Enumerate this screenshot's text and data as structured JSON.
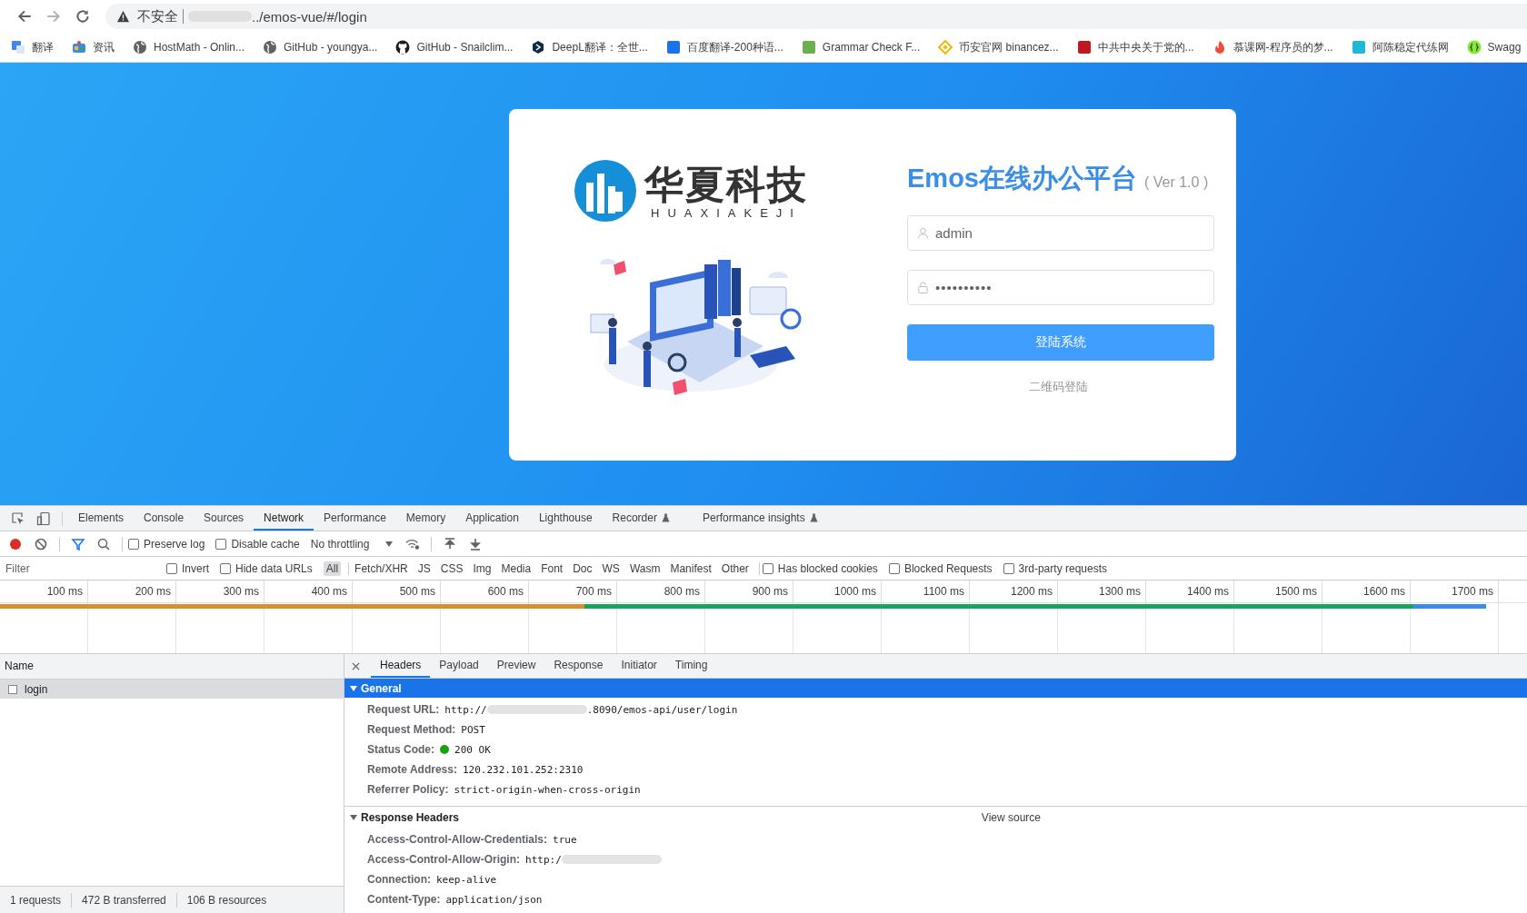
{
  "browser": {
    "security_label": "不安全",
    "url": "../emos-vue/#/login",
    "bookmarks": [
      {
        "kind": "translate",
        "label": "翻译"
      },
      {
        "kind": "news",
        "label": "资讯"
      },
      {
        "kind": "globe",
        "label": "HostMath - Onlin..."
      },
      {
        "kind": "globe",
        "label": "GitHub - youngya..."
      },
      {
        "kind": "github",
        "label": "GitHub - Snailclim..."
      },
      {
        "kind": "deepl",
        "label": "DeepL翻译：全世..."
      },
      {
        "kind": "tile",
        "color": "#1a73e8",
        "label": "百度翻译-200种语..."
      },
      {
        "kind": "tile",
        "color": "#6ab04c",
        "label": "Grammar Check F..."
      },
      {
        "kind": "diamond",
        "label": "币安官网 binancez..."
      },
      {
        "kind": "tile",
        "color": "#c0181f",
        "label": "中共中央关于党的..."
      },
      {
        "kind": "flame",
        "label": "慕课网-程序员的梦..."
      },
      {
        "kind": "tile",
        "color": "#1fb8d6",
        "label": "阿陈稳定代练网"
      },
      {
        "kind": "swagger",
        "label": "Swagg"
      }
    ]
  },
  "login_card": {
    "logo_text": "华夏科技",
    "logo_subtext": "HUAXIAKEJI",
    "title": "Emos在线办公平台",
    "version": "( Ver 1.0 )",
    "username": {
      "value": "admin"
    },
    "password": {
      "value": "••••••••••"
    },
    "submit_button": "登陆系统",
    "qr_link": "二维码登陆"
  },
  "devtools": {
    "tabs": [
      {
        "label": "Elements",
        "selected": false
      },
      {
        "label": "Console",
        "selected": false
      },
      {
        "label": "Sources",
        "selected": false
      },
      {
        "label": "Network",
        "selected": true
      },
      {
        "label": "Performance",
        "selected": false
      },
      {
        "label": "Memory",
        "selected": false
      },
      {
        "label": "Application",
        "selected": false
      },
      {
        "label": "Lighthouse",
        "selected": false
      },
      {
        "label": "Recorder",
        "experimental": true,
        "selected": false
      },
      {
        "label": "Performance insights",
        "experimental": true,
        "selected": false
      }
    ],
    "toolbar": {
      "recording": true,
      "preserve_log": {
        "label": "Preserve log",
        "checked": false
      },
      "disable_cache": {
        "label": "Disable cache",
        "checked": false
      },
      "throttling": "No throttling"
    },
    "filter": {
      "placeholder": "Filter",
      "invert": {
        "label": "Invert",
        "checked": false
      },
      "hide_data_urls": {
        "label": "Hide data URLs",
        "checked": false
      },
      "types": [
        {
          "label": "All",
          "selected": true
        },
        {
          "label": "Fetch/XHR",
          "selected": false
        },
        {
          "label": "JS",
          "selected": false
        },
        {
          "label": "CSS",
          "selected": false
        },
        {
          "label": "Img",
          "selected": false
        },
        {
          "label": "Media",
          "selected": false
        },
        {
          "label": "Font",
          "selected": false
        },
        {
          "label": "Doc",
          "selected": false
        },
        {
          "label": "WS",
          "selected": false
        },
        {
          "label": "Wasm",
          "selected": false
        },
        {
          "label": "Manifest",
          "selected": false
        },
        {
          "label": "Other",
          "selected": false
        }
      ],
      "options": [
        {
          "label": "Has blocked cookies",
          "checked": false
        },
        {
          "label": "Blocked Requests",
          "checked": false
        },
        {
          "label": "3rd-party requests",
          "checked": false
        }
      ]
    },
    "timeline_ticks": [
      "100 ms",
      "200 ms",
      "300 ms",
      "400 ms",
      "500 ms",
      "600 ms",
      "700 ms",
      "800 ms",
      "900 ms",
      "1000 ms",
      "1100 ms",
      "1200 ms",
      "1300 ms",
      "1400 ms",
      "1500 ms",
      "1600 ms",
      "1700 ms"
    ],
    "requests": {
      "column": "Name",
      "rows": [
        {
          "name": "login",
          "selected": true
        }
      ]
    },
    "status_bar": [
      "1 requests",
      "472 B transferred",
      "106 B resources"
    ],
    "detail_tabs": [
      {
        "label": "Headers",
        "selected": true
      },
      {
        "label": "Payload",
        "selected": false
      },
      {
        "label": "Preview",
        "selected": false
      },
      {
        "label": "Response",
        "selected": false
      },
      {
        "label": "Initiator",
        "selected": false
      },
      {
        "label": "Timing",
        "selected": false
      }
    ],
    "sections": [
      {
        "title": "General",
        "expanded": true,
        "highlighted": true,
        "rows": [
          {
            "key": "Request URL:",
            "value": "http://",
            "redacted": true,
            "value_after": ".8090/emos-api/user/login"
          },
          {
            "key": "Request Method:",
            "value": "POST"
          },
          {
            "key": "Status Code:",
            "value": "200 OK",
            "status_dot": true
          },
          {
            "key": "Remote Address:",
            "value": "120.232.101.252:2310"
          },
          {
            "key": "Referrer Policy:",
            "value": "strict-origin-when-cross-origin"
          }
        ]
      },
      {
        "title": "Response Headers",
        "expanded": true,
        "highlighted": false,
        "action": "View source",
        "rows": [
          {
            "key": "Access-Control-Allow-Credentials:",
            "value": "true"
          },
          {
            "key": "Access-Control-Allow-Origin:",
            "value": "http:/",
            "redacted": true
          },
          {
            "key": "Connection:",
            "value": "keep-alive"
          },
          {
            "key": "Content-Type:",
            "value": "application/json"
          }
        ]
      }
    ]
  }
}
